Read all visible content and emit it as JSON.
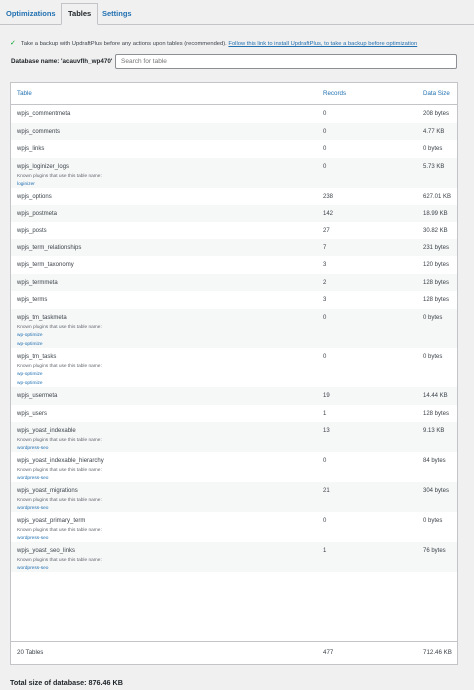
{
  "tabs": [
    {
      "label": "Optimizations"
    },
    {
      "label": "Tables"
    },
    {
      "label": "Settings"
    }
  ],
  "notice": {
    "text": "Take a backup with UpdraftPlus before any actions upon tables (recommended).",
    "link": "Follow this link to install UpdraftPlus, to take a backup before optimization"
  },
  "database": {
    "label": "Database name: 'acauvflh_wp470'",
    "search_placeholder": "Search for table"
  },
  "table": {
    "headers": {
      "table": "Table",
      "records": "Records",
      "size": "Data Size"
    },
    "plugins_label": "Known plugins that use this table name:",
    "rows": [
      {
        "name": "wpjs_commentmeta",
        "records": "0",
        "size": "208 bytes"
      },
      {
        "name": "wpjs_comments",
        "records": "0",
        "size": "4.77 KB"
      },
      {
        "name": "wpjs_links",
        "records": "0",
        "size": "0 bytes"
      },
      {
        "name": "wpjs_loginizer_logs",
        "records": "0",
        "size": "5.73 KB",
        "plugins": [
          "loginizer"
        ]
      },
      {
        "name": "wpjs_options",
        "records": "238",
        "size": "627.01 KB"
      },
      {
        "name": "wpjs_postmeta",
        "records": "142",
        "size": "18.99 KB"
      },
      {
        "name": "wpjs_posts",
        "records": "27",
        "size": "30.82 KB"
      },
      {
        "name": "wpjs_term_relationships",
        "records": "7",
        "size": "231 bytes"
      },
      {
        "name": "wpjs_term_taxonomy",
        "records": "3",
        "size": "120 bytes"
      },
      {
        "name": "wpjs_termmeta",
        "records": "2",
        "size": "128 bytes"
      },
      {
        "name": "wpjs_terms",
        "records": "3",
        "size": "128 bytes"
      },
      {
        "name": "wpjs_tm_taskmeta",
        "records": "0",
        "size": "0 bytes",
        "plugins": [
          "wp-optimize",
          "wp-optimize"
        ]
      },
      {
        "name": "wpjs_tm_tasks",
        "records": "0",
        "size": "0 bytes",
        "plugins": [
          "wp-optimize",
          "wp-optimize"
        ]
      },
      {
        "name": "wpjs_usermeta",
        "records": "19",
        "size": "14.44 KB"
      },
      {
        "name": "wpjs_users",
        "records": "1",
        "size": "128 bytes"
      },
      {
        "name": "wpjs_yoast_indexable",
        "records": "13",
        "size": "9.13 KB",
        "plugins": [
          "wordpress-seo"
        ]
      },
      {
        "name": "wpjs_yoast_indexable_hierarchy",
        "records": "0",
        "size": "84 bytes",
        "plugins": [
          "wordpress-seo"
        ]
      },
      {
        "name": "wpjs_yoast_migrations",
        "records": "21",
        "size": "304 bytes",
        "plugins": [
          "wordpress-seo"
        ]
      },
      {
        "name": "wpjs_yoast_primary_term",
        "records": "0",
        "size": "0 bytes",
        "plugins": [
          "wordpress-seo"
        ]
      },
      {
        "name": "wpjs_yoast_seo_links",
        "records": "1",
        "size": "76 bytes",
        "plugins": [
          "wordpress-seo"
        ]
      }
    ],
    "footer": {
      "tables": "20 Tables",
      "records": "477",
      "size": "712.46 KB"
    }
  },
  "total": "Total size of database: 876.46 KB"
}
